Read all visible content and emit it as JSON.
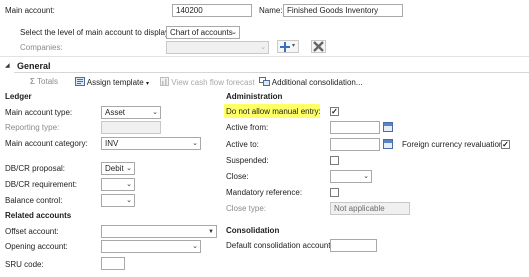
{
  "header": {
    "main_account_label": "Main account:",
    "main_account_value": "140200",
    "name_label": "Name:",
    "name_value": "Finished Goods Inventory",
    "level_label": "Select the level of main account to display:",
    "level_value": "Chart of accounts",
    "companies_label": "Companies:"
  },
  "section": {
    "title": "General",
    "collapse_glyph": "◢"
  },
  "toolbar": {
    "totals": "Totals",
    "assign_template": "Assign template",
    "view_cash_flow": "View cash flow forecast",
    "additional_consolidation": "Additional consolidation..."
  },
  "ledger": {
    "title": "Ledger",
    "main_account_type_label": "Main account type:",
    "main_account_type_value": "Asset",
    "reporting_type_label": "Reporting type:",
    "main_account_category_label": "Main account category:",
    "main_account_category_value": "INV",
    "dc_proposal_label": "DB/CR proposal:",
    "dc_proposal_value": "Debit",
    "dc_requirement_label": "DB/CR requirement:",
    "balance_control_label": "Balance control:"
  },
  "related": {
    "title": "Related accounts",
    "offset_account_label": "Offset account:",
    "opening_account_label": "Opening account:",
    "sru_code_label": "SRU code:"
  },
  "administration": {
    "title": "Administration",
    "do_not_allow_label": "Do not allow manual entry:",
    "do_not_allow_checked": true,
    "highlight_color": "#ffff66",
    "active_from_label": "Active from:",
    "active_to_label": "Active to:",
    "foreign_currency_label": "Foreign currency revaluation:",
    "foreign_currency_checked": true,
    "suspended_label": "Suspended:",
    "close_label": "Close:",
    "mandatory_reference_label": "Mandatory reference:",
    "close_type_label": "Close type:",
    "close_type_value": "Not applicable"
  },
  "consolidation": {
    "title": "Consolidation",
    "default_account_label": "Default consolidation account:"
  },
  "glyphs": {
    "dropdown": "⌄",
    "check": "✓",
    "caret": "▾",
    "triangle_down": "▼"
  },
  "colors": {
    "section_rule": "#d6d6d6",
    "icon_blue": "#3a6fc0",
    "icon_red": "#c0392b"
  }
}
